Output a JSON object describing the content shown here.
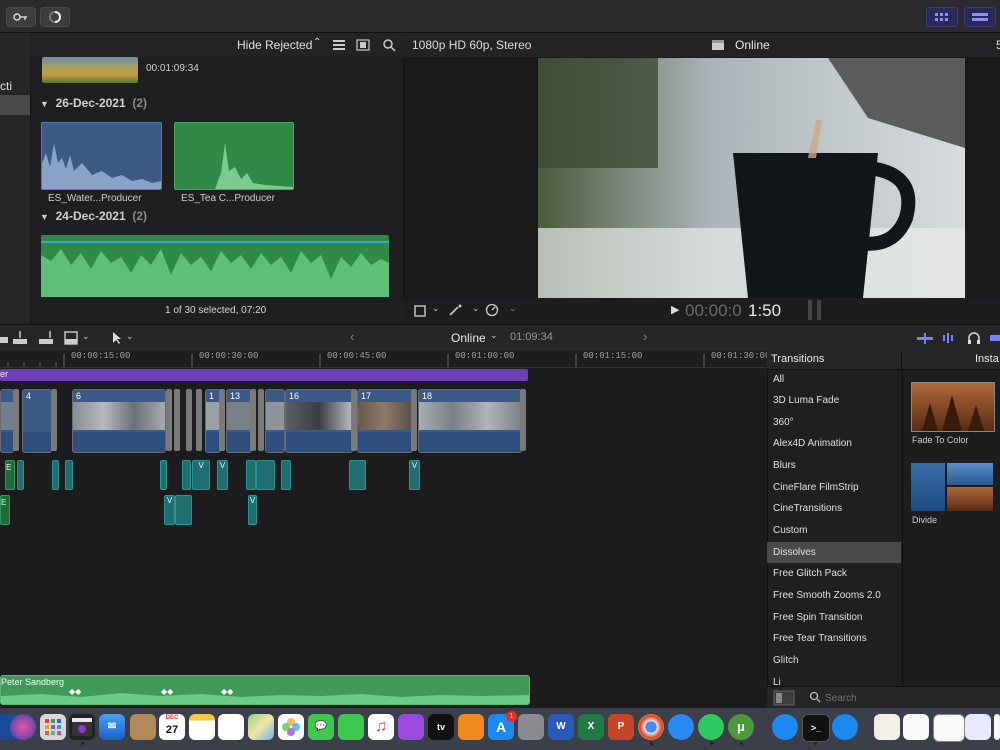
{
  "browser": {
    "sidebar_label": "cti",
    "filter": "Hide Rejected",
    "top_clip_duration": "00:01:09:34",
    "groups": [
      {
        "date": "26-Dec-2021",
        "count": "(2)",
        "clips": [
          {
            "name": "ES_Water...Producer"
          },
          {
            "name": "ES_Tea C...Producer"
          }
        ]
      },
      {
        "date": "24-Dec-2021",
        "count": "(2)"
      }
    ],
    "status": "1 of 30 selected, 07:20"
  },
  "viewer": {
    "format": "1080p HD 60p, Stereo",
    "project": "Online",
    "timecode_dim": "00:00:0",
    "timecode_bright": "1:50",
    "right_edge": "5"
  },
  "timeline": {
    "project": "Online",
    "duration": "01:09:34",
    "ruler": [
      "00:00:15:00",
      "00:00:30:00",
      "00:00:45:00",
      "00:01:00:00",
      "00:01:15:00",
      "00:01:30:00"
    ],
    "title_bar_label": "er",
    "clip_numbers": [
      "4",
      "6",
      "1",
      "13",
      "16",
      "17",
      "18"
    ],
    "connected_labels": [
      "E",
      "E",
      "V",
      "V",
      "V",
      "V",
      "V"
    ],
    "music_label": "Peter Sandberg"
  },
  "transitions": {
    "header": "Transitions",
    "right_header": "Insta",
    "categories": [
      "All",
      "3D Luma Fade",
      "360°",
      "Alex4D Animation",
      "Blurs",
      "CineFlare FilmStrip",
      "CineTransitions",
      "Custom",
      "Dissolves",
      "Free Glitch Pack",
      "Free Smooth Zooms 2.0",
      "Free Spin Transition",
      "Free Tear Transitions",
      "Glitch",
      "Li"
    ],
    "selected": "Dissolves",
    "previews": [
      {
        "name": "Fade To Color"
      },
      {
        "name": "Divide"
      }
    ],
    "search_placeholder": "Search"
  },
  "dock": {
    "calendar_day": "27",
    "calendar_month": "DEC",
    "appstore_badge": "1"
  },
  "colors": {
    "accent_purple": "#6e3fb4",
    "clip_blue": "#3c5a86",
    "audio_green": "#3f9a59",
    "connected_teal": "#1f6f70"
  }
}
